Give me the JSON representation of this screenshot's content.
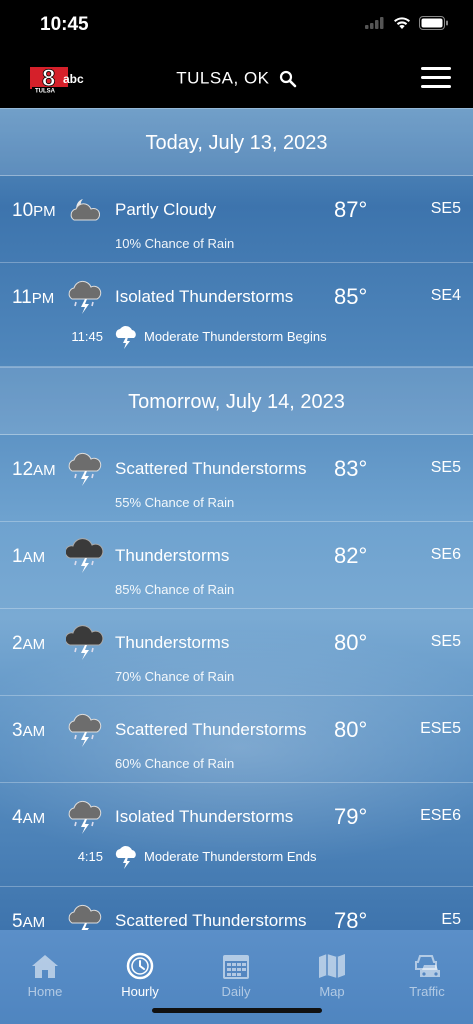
{
  "status_bar": {
    "time": "10:45"
  },
  "header": {
    "logo_text": "8 abc TULSA",
    "location": "TULSA, OK"
  },
  "days": [
    {
      "label": "Today, July 13, 2023"
    },
    {
      "label": "Tomorrow, July 14, 2023"
    }
  ],
  "hours": [
    {
      "hour": "10",
      "ampm": "PM",
      "icon": "partly-cloudy-night-icon",
      "condition": "Partly Cloudy",
      "temp": "87°",
      "wind": "SE5",
      "rain": "10% Chance of Rain"
    },
    {
      "hour": "11",
      "ampm": "PM",
      "icon": "thunderstorm-icon",
      "condition": "Isolated Thunderstorms",
      "temp": "85°",
      "wind": "SE4",
      "alert_time": "11:45",
      "alert_text": "Moderate Thunderstorm Begins"
    },
    {
      "hour": "12",
      "ampm": "AM",
      "icon": "thunderstorm-icon",
      "condition": "Scattered Thunderstorms",
      "temp": "83°",
      "wind": "SE5",
      "rain": "55% Chance of Rain"
    },
    {
      "hour": "1",
      "ampm": "AM",
      "icon": "dark-thunderstorm-icon",
      "condition": "Thunderstorms",
      "temp": "82°",
      "wind": "SE6",
      "rain": "85% Chance of Rain"
    },
    {
      "hour": "2",
      "ampm": "AM",
      "icon": "dark-thunderstorm-icon",
      "condition": "Thunderstorms",
      "temp": "80°",
      "wind": "SE5",
      "rain": "70% Chance of Rain"
    },
    {
      "hour": "3",
      "ampm": "AM",
      "icon": "thunderstorm-icon",
      "condition": "Scattered Thunderstorms",
      "temp": "80°",
      "wind": "ESE5",
      "rain": "60% Chance of Rain"
    },
    {
      "hour": "4",
      "ampm": "AM",
      "icon": "thunderstorm-icon",
      "condition": "Isolated Thunderstorms",
      "temp": "79°",
      "wind": "ESE6",
      "alert_time": "4:15",
      "alert_text": "Moderate Thunderstorm Ends"
    },
    {
      "hour": "5",
      "ampm": "AM",
      "icon": "thunderstorm-icon",
      "condition": "Scattered Thunderstorms",
      "temp": "78°",
      "wind": "E5"
    }
  ],
  "tabs": [
    {
      "label": "Home",
      "icon": "home-icon",
      "active": false
    },
    {
      "label": "Hourly",
      "icon": "clock-icon",
      "active": true
    },
    {
      "label": "Daily",
      "icon": "calendar-icon",
      "active": false
    },
    {
      "label": "Map",
      "icon": "map-icon",
      "active": false
    },
    {
      "label": "Traffic",
      "icon": "traffic-icon",
      "active": false
    }
  ],
  "colors": {
    "accent": "#5b8fc8",
    "header_bg": "#000000",
    "logo_red": "#d5202a"
  }
}
